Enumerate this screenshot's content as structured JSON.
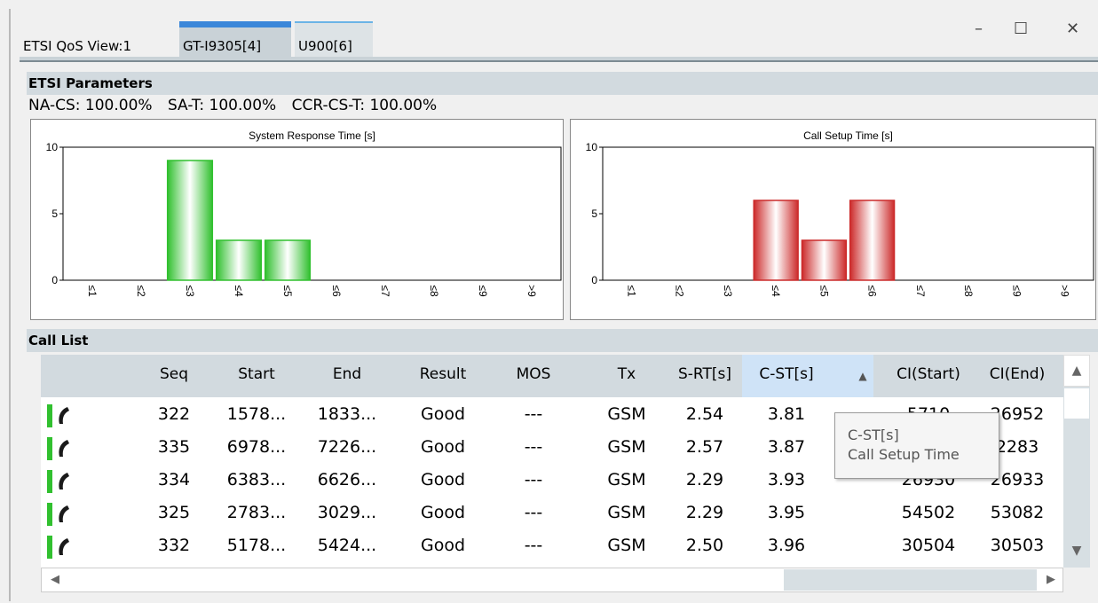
{
  "window": {
    "title": "ETSI QoS View:1",
    "tabs": [
      {
        "label": "GT-I9305[4]"
      },
      {
        "label": "U900[6]"
      }
    ],
    "controls": {
      "minimize": "–",
      "maximize": "☐",
      "close": "✕"
    },
    "colors": {
      "active_tab_accent": "#3b87d9",
      "inactive_tab_accent": "#6bb4e6",
      "header_bg": "#d2dadf"
    }
  },
  "etsi": {
    "header": "ETSI Parameters",
    "params": [
      {
        "text": "NA-CS:  100.00%"
      },
      {
        "text": "SA-T:  100.00%"
      },
      {
        "text": "CCR-CS-T:  100.00%"
      }
    ]
  },
  "chart_data": [
    {
      "type": "bar",
      "title": "System Response Time [s]",
      "categories": [
        "≤1",
        "≤2",
        "≤3",
        "≤4",
        "≤5",
        "≤6",
        "≤7",
        "≤8",
        "≤9",
        ">9"
      ],
      "values": [
        0,
        0,
        9,
        3,
        3,
        0,
        0,
        0,
        0,
        0
      ],
      "yticks": [
        0,
        5,
        10
      ],
      "ylim": [
        0,
        10
      ],
      "color": "#31c02f"
    },
    {
      "type": "bar",
      "title": "Call Setup Time [s]",
      "categories": [
        "≤1",
        "≤2",
        "≤3",
        "≤4",
        "≤5",
        "≤6",
        "≤7",
        "≤8",
        "≤9",
        ">9"
      ],
      "values": [
        0,
        0,
        0,
        6,
        3,
        6,
        0,
        0,
        0,
        0
      ],
      "yticks": [
        0,
        5,
        10
      ],
      "ylim": [
        0,
        10
      ],
      "color": "#cc2b2b"
    }
  ],
  "call_list": {
    "header": "Call List",
    "columns": [
      "Seq",
      "Start",
      "End",
      "Result",
      "MOS",
      "Tx",
      "S-RT[s]",
      "C-ST[s]",
      "CI(Start)",
      "CI(End)"
    ],
    "sort_indicator": "▲",
    "rows": [
      [
        "322",
        "1578...",
        "1833...",
        "Good",
        "---",
        "GSM",
        "2.54",
        "3.81",
        "5710",
        "26952"
      ],
      [
        "335",
        "6978...",
        "7226...",
        "Good",
        "---",
        "GSM",
        "2.57",
        "3.87",
        "",
        "2283"
      ],
      [
        "334",
        "6383...",
        "6626...",
        "Good",
        "---",
        "GSM",
        "2.29",
        "3.93",
        "26930",
        "26933"
      ],
      [
        "325",
        "2783...",
        "3029...",
        "Good",
        "---",
        "GSM",
        "2.29",
        "3.95",
        "54502",
        "53082"
      ],
      [
        "332",
        "5178...",
        "5424...",
        "Good",
        "---",
        "GSM",
        "2.50",
        "3.96",
        "30504",
        "30503"
      ]
    ],
    "row_icon": "phone-call-icon"
  },
  "tooltip": {
    "line1": "C-ST[s]",
    "line2": "Call Setup Time"
  },
  "scroll": {
    "up": "▲",
    "down": "▼",
    "left": "◀",
    "right": "▶"
  }
}
